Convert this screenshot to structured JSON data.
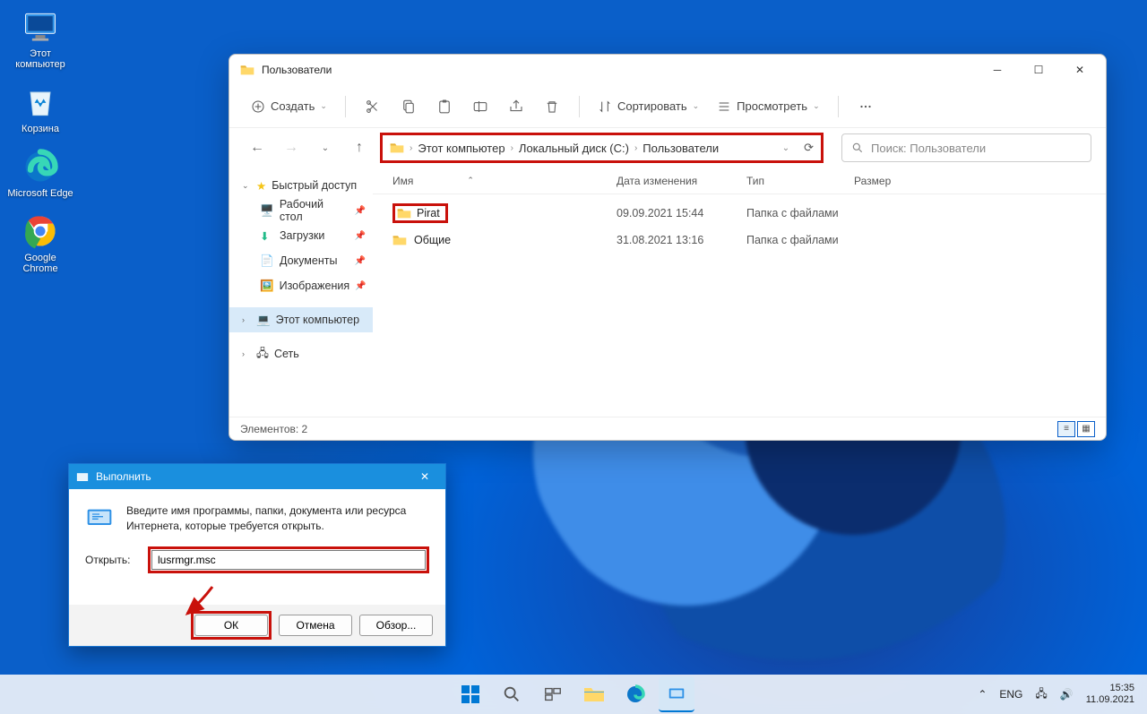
{
  "desktop": {
    "icons": [
      {
        "label": "Этот компьютер",
        "name": "this-pc"
      },
      {
        "label": "Корзина",
        "name": "recycle-bin"
      },
      {
        "label": "Microsoft Edge",
        "name": "edge"
      },
      {
        "label": "Google Chrome",
        "name": "chrome"
      }
    ]
  },
  "explorer": {
    "title": "Пользователи",
    "toolbar": {
      "new": "Создать",
      "sort": "Сортировать",
      "view": "Просмотреть"
    },
    "breadcrumb": [
      "Этот компьютер",
      "Локальный диск (C:)",
      "Пользователи"
    ],
    "search_placeholder": "Поиск: Пользователи",
    "sidebar": {
      "quick": "Быстрый доступ",
      "items": [
        {
          "label": "Рабочий стол"
        },
        {
          "label": "Загрузки"
        },
        {
          "label": "Документы"
        },
        {
          "label": "Изображения"
        }
      ],
      "thispc": "Этот компьютер",
      "network": "Сеть"
    },
    "columns": {
      "name": "Имя",
      "date": "Дата изменения",
      "type": "Тип",
      "size": "Размер"
    },
    "rows": [
      {
        "name": "Pirat",
        "date": "09.09.2021 15:44",
        "type": "Папка с файлами",
        "highlight": true
      },
      {
        "name": "Общие",
        "date": "31.08.2021 13:16",
        "type": "Папка с файлами",
        "highlight": false
      }
    ],
    "status": "Элементов: 2"
  },
  "run": {
    "title": "Выполнить",
    "desc": "Введите имя программы, папки, документа или ресурса Интернета, которые требуется открыть.",
    "open_label": "Открыть:",
    "value": "lusrmgr.msc",
    "ok": "ОК",
    "cancel": "Отмена",
    "browse": "Обзор..."
  },
  "taskbar": {
    "lang": "ENG",
    "time": "15:35",
    "date": "11.09.2021"
  }
}
